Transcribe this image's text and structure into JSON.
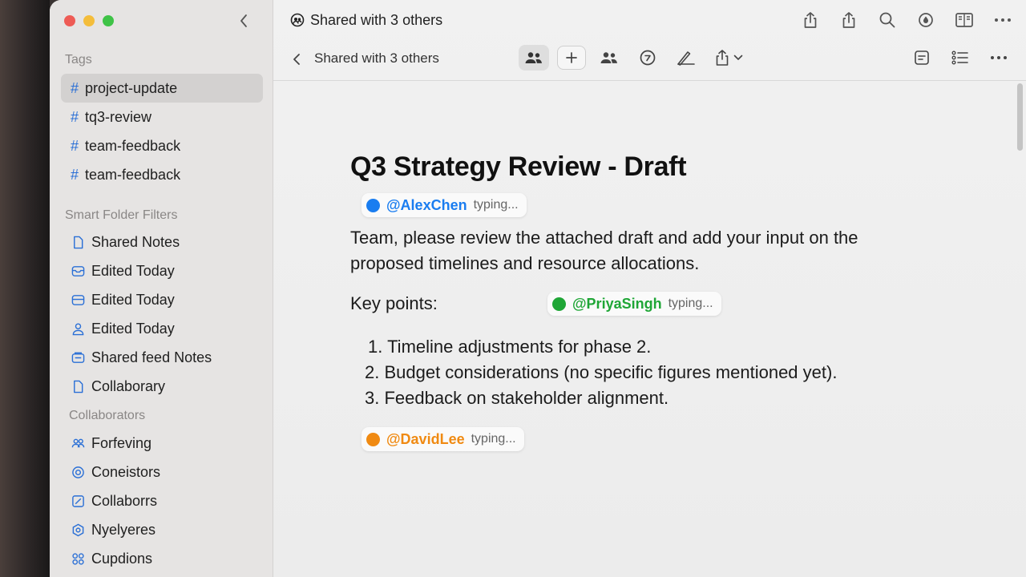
{
  "window": {
    "title": "Shared with 3 others",
    "breadcrumb": "Shared with 3 others"
  },
  "sidebar": {
    "tags_title": "Tags",
    "tags": [
      {
        "label": "project-update",
        "selected": true
      },
      {
        "label": "tq3-review",
        "selected": false
      },
      {
        "label": "team-feedback",
        "selected": false
      },
      {
        "label": "team-feedback",
        "selected": false
      }
    ],
    "smart_title": "Smart Folder Filters",
    "smart": [
      {
        "label": "Shared Notes",
        "icon": "doc-icon"
      },
      {
        "label": "Edited Today",
        "icon": "tray-icon"
      },
      {
        "label": "Edited Today",
        "icon": "tray-icon"
      },
      {
        "label": "Edited Today",
        "icon": "person-icon"
      },
      {
        "label": "Shared feed Notes",
        "icon": "tray-icon"
      },
      {
        "label": "Collaborary",
        "icon": "doc-icon"
      }
    ],
    "collab_title": "Collaborators",
    "collaborators": [
      {
        "label": "Forfeving",
        "icon": "people-icon"
      },
      {
        "label": "Coneistors",
        "icon": "circle-icon"
      },
      {
        "label": "Collaborrs",
        "icon": "edit-icon"
      },
      {
        "label": "Nyelyeres",
        "icon": "gear-icon"
      },
      {
        "label": "Cupdions",
        "icon": "grid-icon"
      }
    ]
  },
  "document": {
    "title": "Q3 Strategy Review - Draft",
    "paragraph": "Team, please review the attached draft and add your input on the proposed timelines and resource allocations.",
    "key_label": "Key points:",
    "points": [
      "1. Timeline adjustments for phase 2.",
      "2. Budget considerations (no specific figures mentioned yet).",
      "3. Feedback on stakeholder alignment."
    ]
  },
  "presence": [
    {
      "handle": "@AlexChen",
      "status": "typing...",
      "color": "#1a7df0"
    },
    {
      "handle": "@PriyaSingh",
      "status": "typing...",
      "color": "#1fa636"
    },
    {
      "handle": "@DavidLee",
      "status": "typing...",
      "color": "#f08a12"
    }
  ],
  "colors": {
    "accent": "#2a6fd6"
  }
}
